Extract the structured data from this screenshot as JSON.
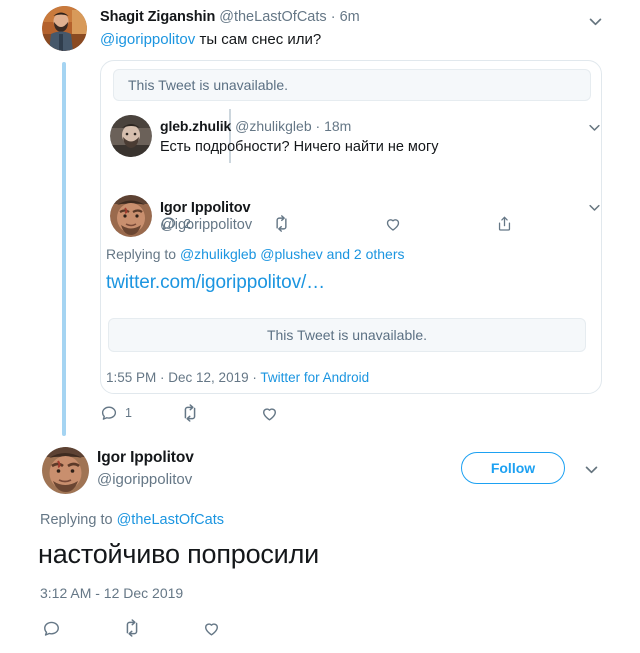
{
  "theme": {
    "accent": "#1da1f2",
    "link": "#1b95e0",
    "muted_text": "#657786",
    "primary_text": "#14171a",
    "thread_line": "#a5d4f2",
    "card_border": "#e1e8ed",
    "unavailable_bg": "#f5f8fa"
  },
  "tweet_one": {
    "author_name": "Shagit Ziganshin",
    "author_handle": "@theLastOfCats",
    "separator": "·",
    "time_ago": "6m",
    "body_mention": "@igorippolitov",
    "body_text": "ты сам снес или?",
    "caret_icon": "chevron-down-icon",
    "avatar_alt": "avatar-shagit-ziganshin",
    "actions": {
      "reply_count": "1",
      "retweet_count": "",
      "like_count": ""
    }
  },
  "quoted_card": {
    "unavailable_top": "This Tweet is unavailable.",
    "unavailable_bottom": "This Tweet is unavailable.",
    "nested_reply": {
      "author_name": "gleb.zhulik",
      "author_handle": "@zhulikgleb",
      "separator": "·",
      "time_ago": "18m",
      "body_text": "Есть подробности? Ничего найти не могу",
      "caret_icon": "chevron-down-icon",
      "avatar_alt": "avatar-gleb-zhulik",
      "actions": {
        "reply_count": "2",
        "retweet_count": "",
        "like_count": "",
        "share_label": ""
      }
    },
    "nested_author": {
      "author_name": "Igor Ippolitov",
      "author_handle": "@igorippolitov",
      "caret_icon": "chevron-down-icon",
      "avatar_alt": "avatar-igor-ippolitov-nested"
    },
    "replying_to_prefix": "Replying to ",
    "replying_to_handles": "@zhulikgleb @plushev",
    "replying_to_suffix": " and 2 others",
    "shared_link": "twitter.com/igorippolitov/…",
    "timestamp_time": "1:55 PM",
    "timestamp_sep_one": " · ",
    "timestamp_date": "Dec 12, 2019",
    "timestamp_sep_two": " · ",
    "timestamp_client": "Twitter for Android"
  },
  "tweet_two": {
    "author_name": "Igor Ippolitov",
    "author_handle": "@igorippolitov",
    "follow_label": "Follow",
    "caret_icon": "chevron-down-icon",
    "avatar_alt": "avatar-igor-ippolitov",
    "replying_to_prefix": "Replying to ",
    "replying_to_handle": "@theLastOfCats",
    "body_text": "настойчиво попросили",
    "timestamp": "3:12 AM - 12 Dec 2019",
    "actions": {
      "reply_count": "",
      "retweet_count": "",
      "like_count": ""
    }
  },
  "icons": {
    "reply": "reply-icon",
    "retweet": "retweet-icon",
    "like": "like-icon",
    "share": "share-icon",
    "chevron": "chevron-down-icon"
  }
}
